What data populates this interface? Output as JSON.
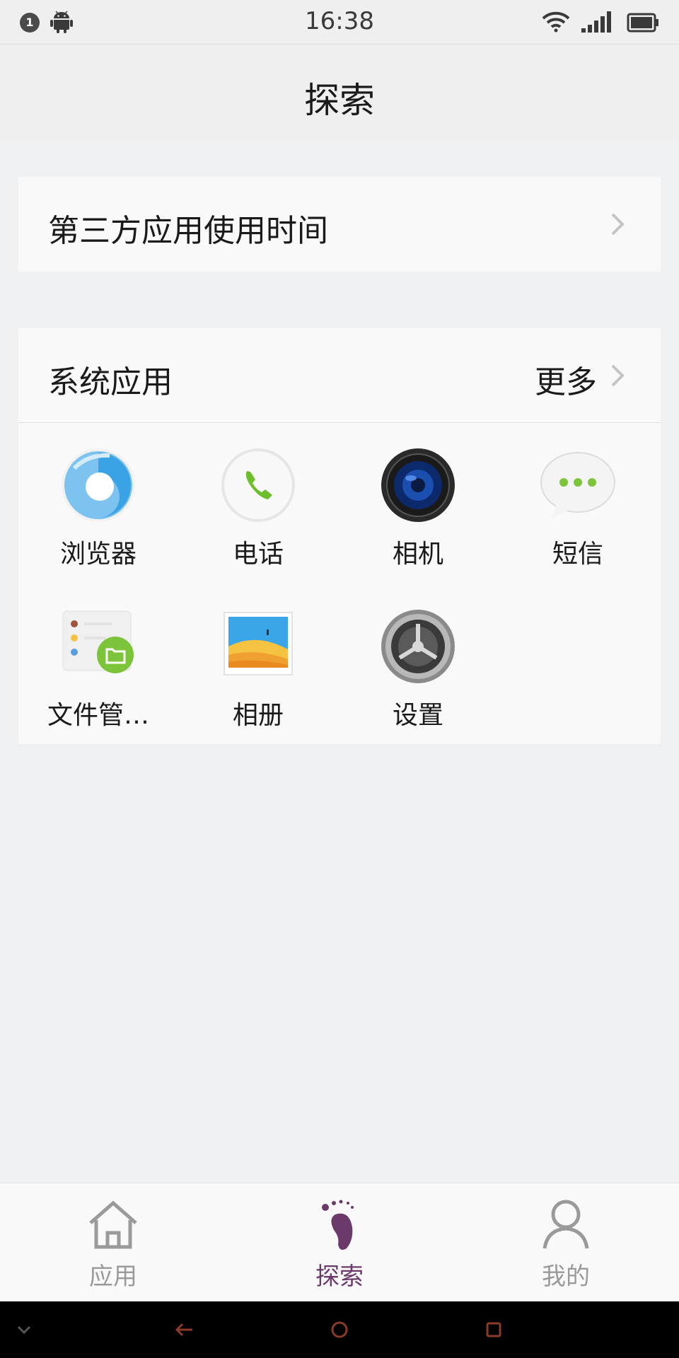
{
  "status_bar": {
    "notification_count": "1",
    "time": "16:38",
    "icons": [
      "android-icon",
      "wifi-icon",
      "signal-icon",
      "battery-icon"
    ]
  },
  "header": {
    "title": "探索"
  },
  "usage_card": {
    "label": "第三方应用使用时间"
  },
  "system_apps": {
    "label": "系统应用",
    "more_label": "更多",
    "apps": [
      {
        "name": "浏览器",
        "icon": "browser-icon"
      },
      {
        "name": "电话",
        "icon": "phone-icon"
      },
      {
        "name": "相机",
        "icon": "camera-icon"
      },
      {
        "name": "短信",
        "icon": "messages-icon"
      },
      {
        "name": "文件管…",
        "icon": "file-manager-icon"
      },
      {
        "name": "相册",
        "icon": "gallery-icon"
      },
      {
        "name": "设置",
        "icon": "settings-icon"
      }
    ]
  },
  "bottom_nav": {
    "items": [
      {
        "label": "应用",
        "icon": "home-icon",
        "active": false
      },
      {
        "label": "探索",
        "icon": "footprint-icon",
        "active": true
      },
      {
        "label": "我的",
        "icon": "person-icon",
        "active": false
      }
    ],
    "active_color": "#6b3a6b",
    "inactive_color": "#9a9a9a"
  },
  "system_nav": {
    "icons": [
      "collapse-icon",
      "back-icon",
      "home-circle-icon",
      "recents-icon"
    ],
    "icon_color": "#8b3a2a"
  }
}
